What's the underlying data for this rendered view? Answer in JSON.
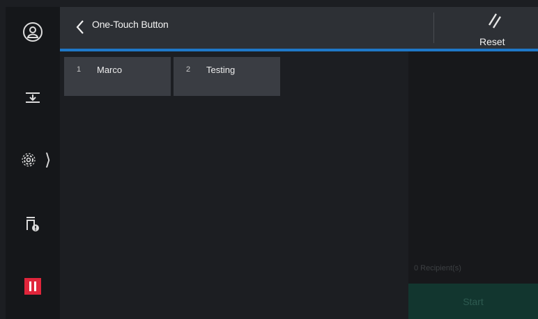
{
  "header": {
    "title": "One-Touch Button",
    "reset_label": "Reset"
  },
  "tiles": [
    {
      "number": "1",
      "label": "Marco"
    },
    {
      "number": "2",
      "label": "Testing"
    }
  ],
  "right_panel": {
    "recipients": "0 Recipient(s)",
    "start_label": "Start"
  },
  "sidebar": {
    "items": [
      "user-icon",
      "sheet-feed-icon",
      "settings-gear-icon",
      "printer-status-icon",
      "stop-icon"
    ]
  },
  "colors": {
    "accent": "#1f78c8",
    "stop": "#e0253b",
    "start_bg": "#12362f"
  }
}
